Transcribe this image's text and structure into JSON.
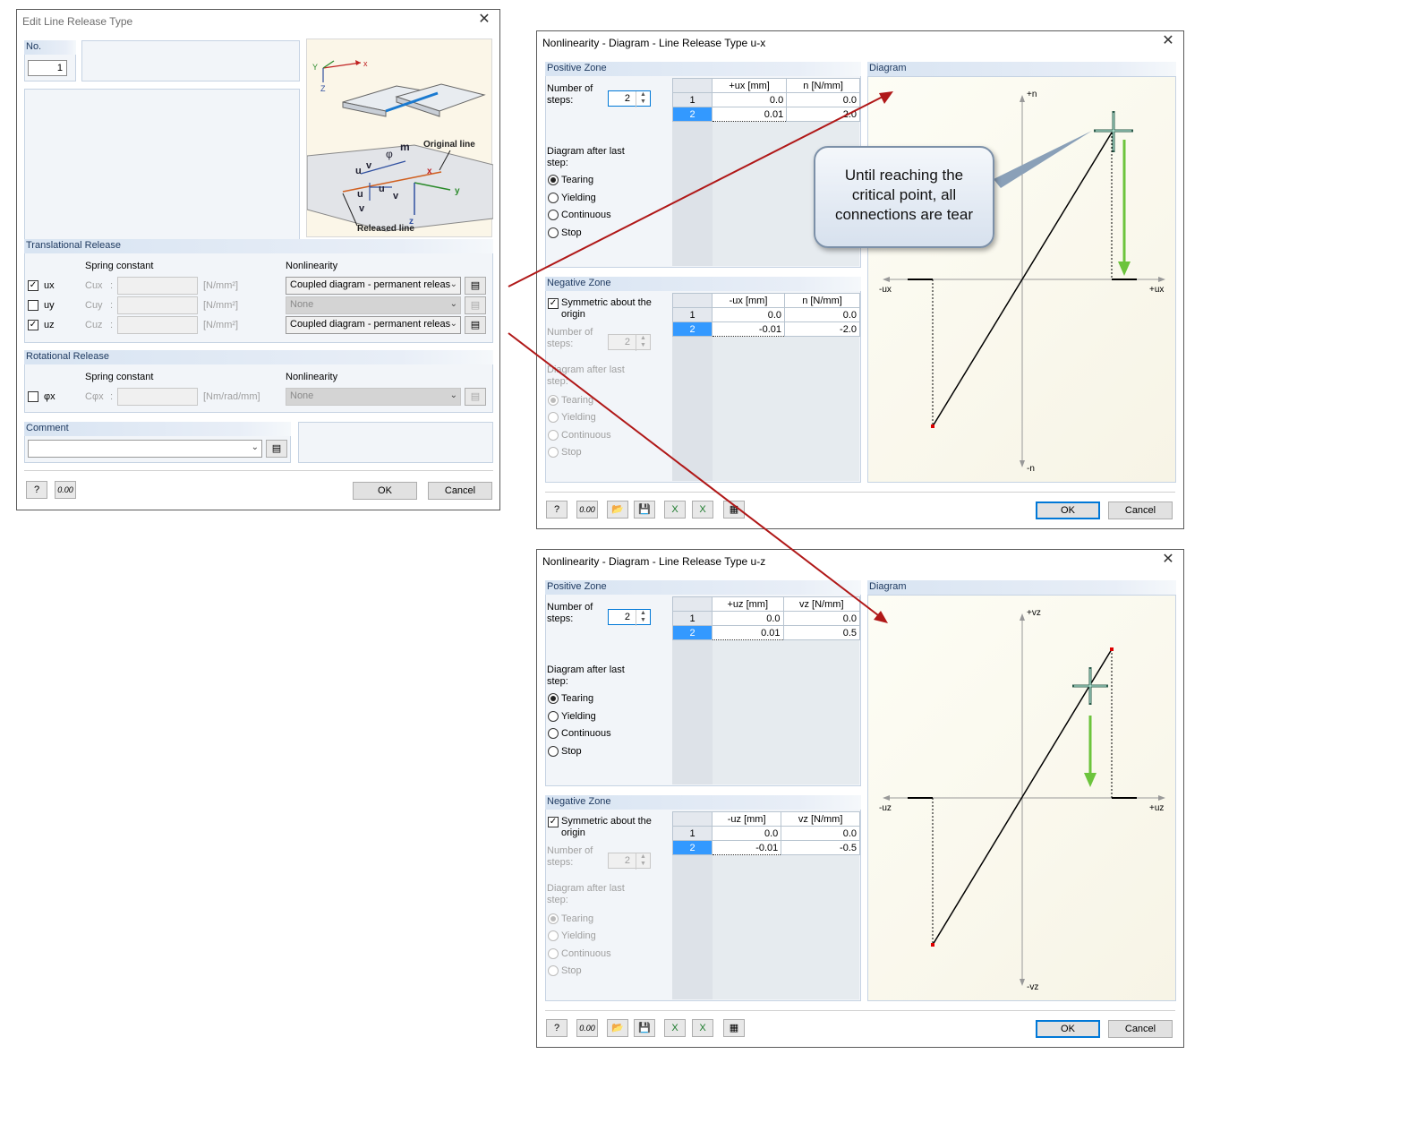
{
  "edit_dialog": {
    "title": "Edit Line Release Type",
    "no_label": "No.",
    "no_value": "1",
    "image_labels": {
      "original_line": "Original line",
      "released_line": "Released line",
      "x": "x",
      "y": "y",
      "z": "z",
      "Y": "Y",
      "Z": "Z"
    },
    "translational": {
      "title": "Translational Release",
      "spring_header": "Spring constant",
      "nonlin_header": "Nonlinearity",
      "rows": [
        {
          "label": "ux",
          "checked": true,
          "c_label": "Cux",
          "unit": "[N/mm²]",
          "nonlinearity": "Coupled diagram - permanent releas",
          "enabled": true
        },
        {
          "label": "uy",
          "checked": false,
          "c_label": "Cuy",
          "unit": "[N/mm²]",
          "nonlinearity": "None",
          "enabled": false
        },
        {
          "label": "uz",
          "checked": true,
          "c_label": "Cuz",
          "unit": "[N/mm²]",
          "nonlinearity": "Coupled diagram - permanent releas",
          "enabled": true
        }
      ]
    },
    "rotational": {
      "title": "Rotational Release",
      "spring_header": "Spring constant",
      "nonlin_header": "Nonlinearity",
      "row": {
        "label": "φx",
        "checked": false,
        "c_label": "Cφx",
        "unit": "[Nm/rad/mm]",
        "nonlinearity": "None"
      }
    },
    "comment_label": "Comment",
    "ok": "OK",
    "cancel": "Cancel",
    "units_icon": "0.00"
  },
  "dialog_ux": {
    "title": "Nonlinearity - Diagram - Line Release Type u-x",
    "positive_zone": {
      "title": "Positive Zone",
      "steps_label": "Number of steps:",
      "steps": "2",
      "col1": "+ux [mm]",
      "col2": "n [N/mm]",
      "rows": [
        [
          "1",
          "0.0",
          "0.0"
        ],
        [
          "2",
          "0.01",
          "2.0"
        ]
      ],
      "after_label": "Diagram after last step:",
      "options": [
        "Tearing",
        "Yielding",
        "Continuous",
        "Stop"
      ],
      "selected": "Tearing"
    },
    "negative_zone": {
      "title": "Negative Zone",
      "symmetric_label": "Symmetric about the origin",
      "steps_label": "Number of steps:",
      "steps": "2",
      "col1": "-ux [mm]",
      "col2": "n [N/mm]",
      "rows": [
        [
          "1",
          "0.0",
          "0.0"
        ],
        [
          "2",
          "-0.01",
          "-2.0"
        ]
      ],
      "after_label": "Diagram after last step:",
      "options": [
        "Tearing",
        "Yielding",
        "Continuous",
        "Stop"
      ],
      "selected": "Tearing"
    },
    "diagram": {
      "title": "Diagram",
      "top": "+n",
      "bottom": "-n",
      "left": "-ux",
      "right": "+ux"
    },
    "callout": "Until reaching the critical point, all connections are tear",
    "ok": "OK",
    "cancel": "Cancel"
  },
  "dialog_uz": {
    "title": "Nonlinearity - Diagram - Line Release Type u-z",
    "positive_zone": {
      "title": "Positive Zone",
      "steps_label": "Number of steps:",
      "steps": "2",
      "col1": "+uz [mm]",
      "col2": "vz [N/mm]",
      "rows": [
        [
          "1",
          "0.0",
          "0.0"
        ],
        [
          "2",
          "0.01",
          "0.5"
        ]
      ],
      "after_label": "Diagram after last step:",
      "options": [
        "Tearing",
        "Yielding",
        "Continuous",
        "Stop"
      ],
      "selected": "Tearing"
    },
    "negative_zone": {
      "title": "Negative Zone",
      "symmetric_label": "Symmetric about the origin",
      "steps_label": "Number of steps:",
      "steps": "2",
      "col1": "-uz [mm]",
      "col2": "vz [N/mm]",
      "rows": [
        [
          "1",
          "0.0",
          "0.0"
        ],
        [
          "2",
          "-0.01",
          "-0.5"
        ]
      ],
      "after_label": "Diagram after last step:",
      "options": [
        "Tearing",
        "Yielding",
        "Continuous",
        "Stop"
      ],
      "selected": "Tearing"
    },
    "diagram": {
      "title": "Diagram",
      "top": "+vz",
      "bottom": "-vz",
      "left": "-uz",
      "right": "+uz"
    },
    "ok": "OK",
    "cancel": "Cancel"
  },
  "colors": {
    "accent": "#0078d7",
    "arrow": "#b01818",
    "green": "#6cc43c",
    "selection": "#3399ff"
  }
}
